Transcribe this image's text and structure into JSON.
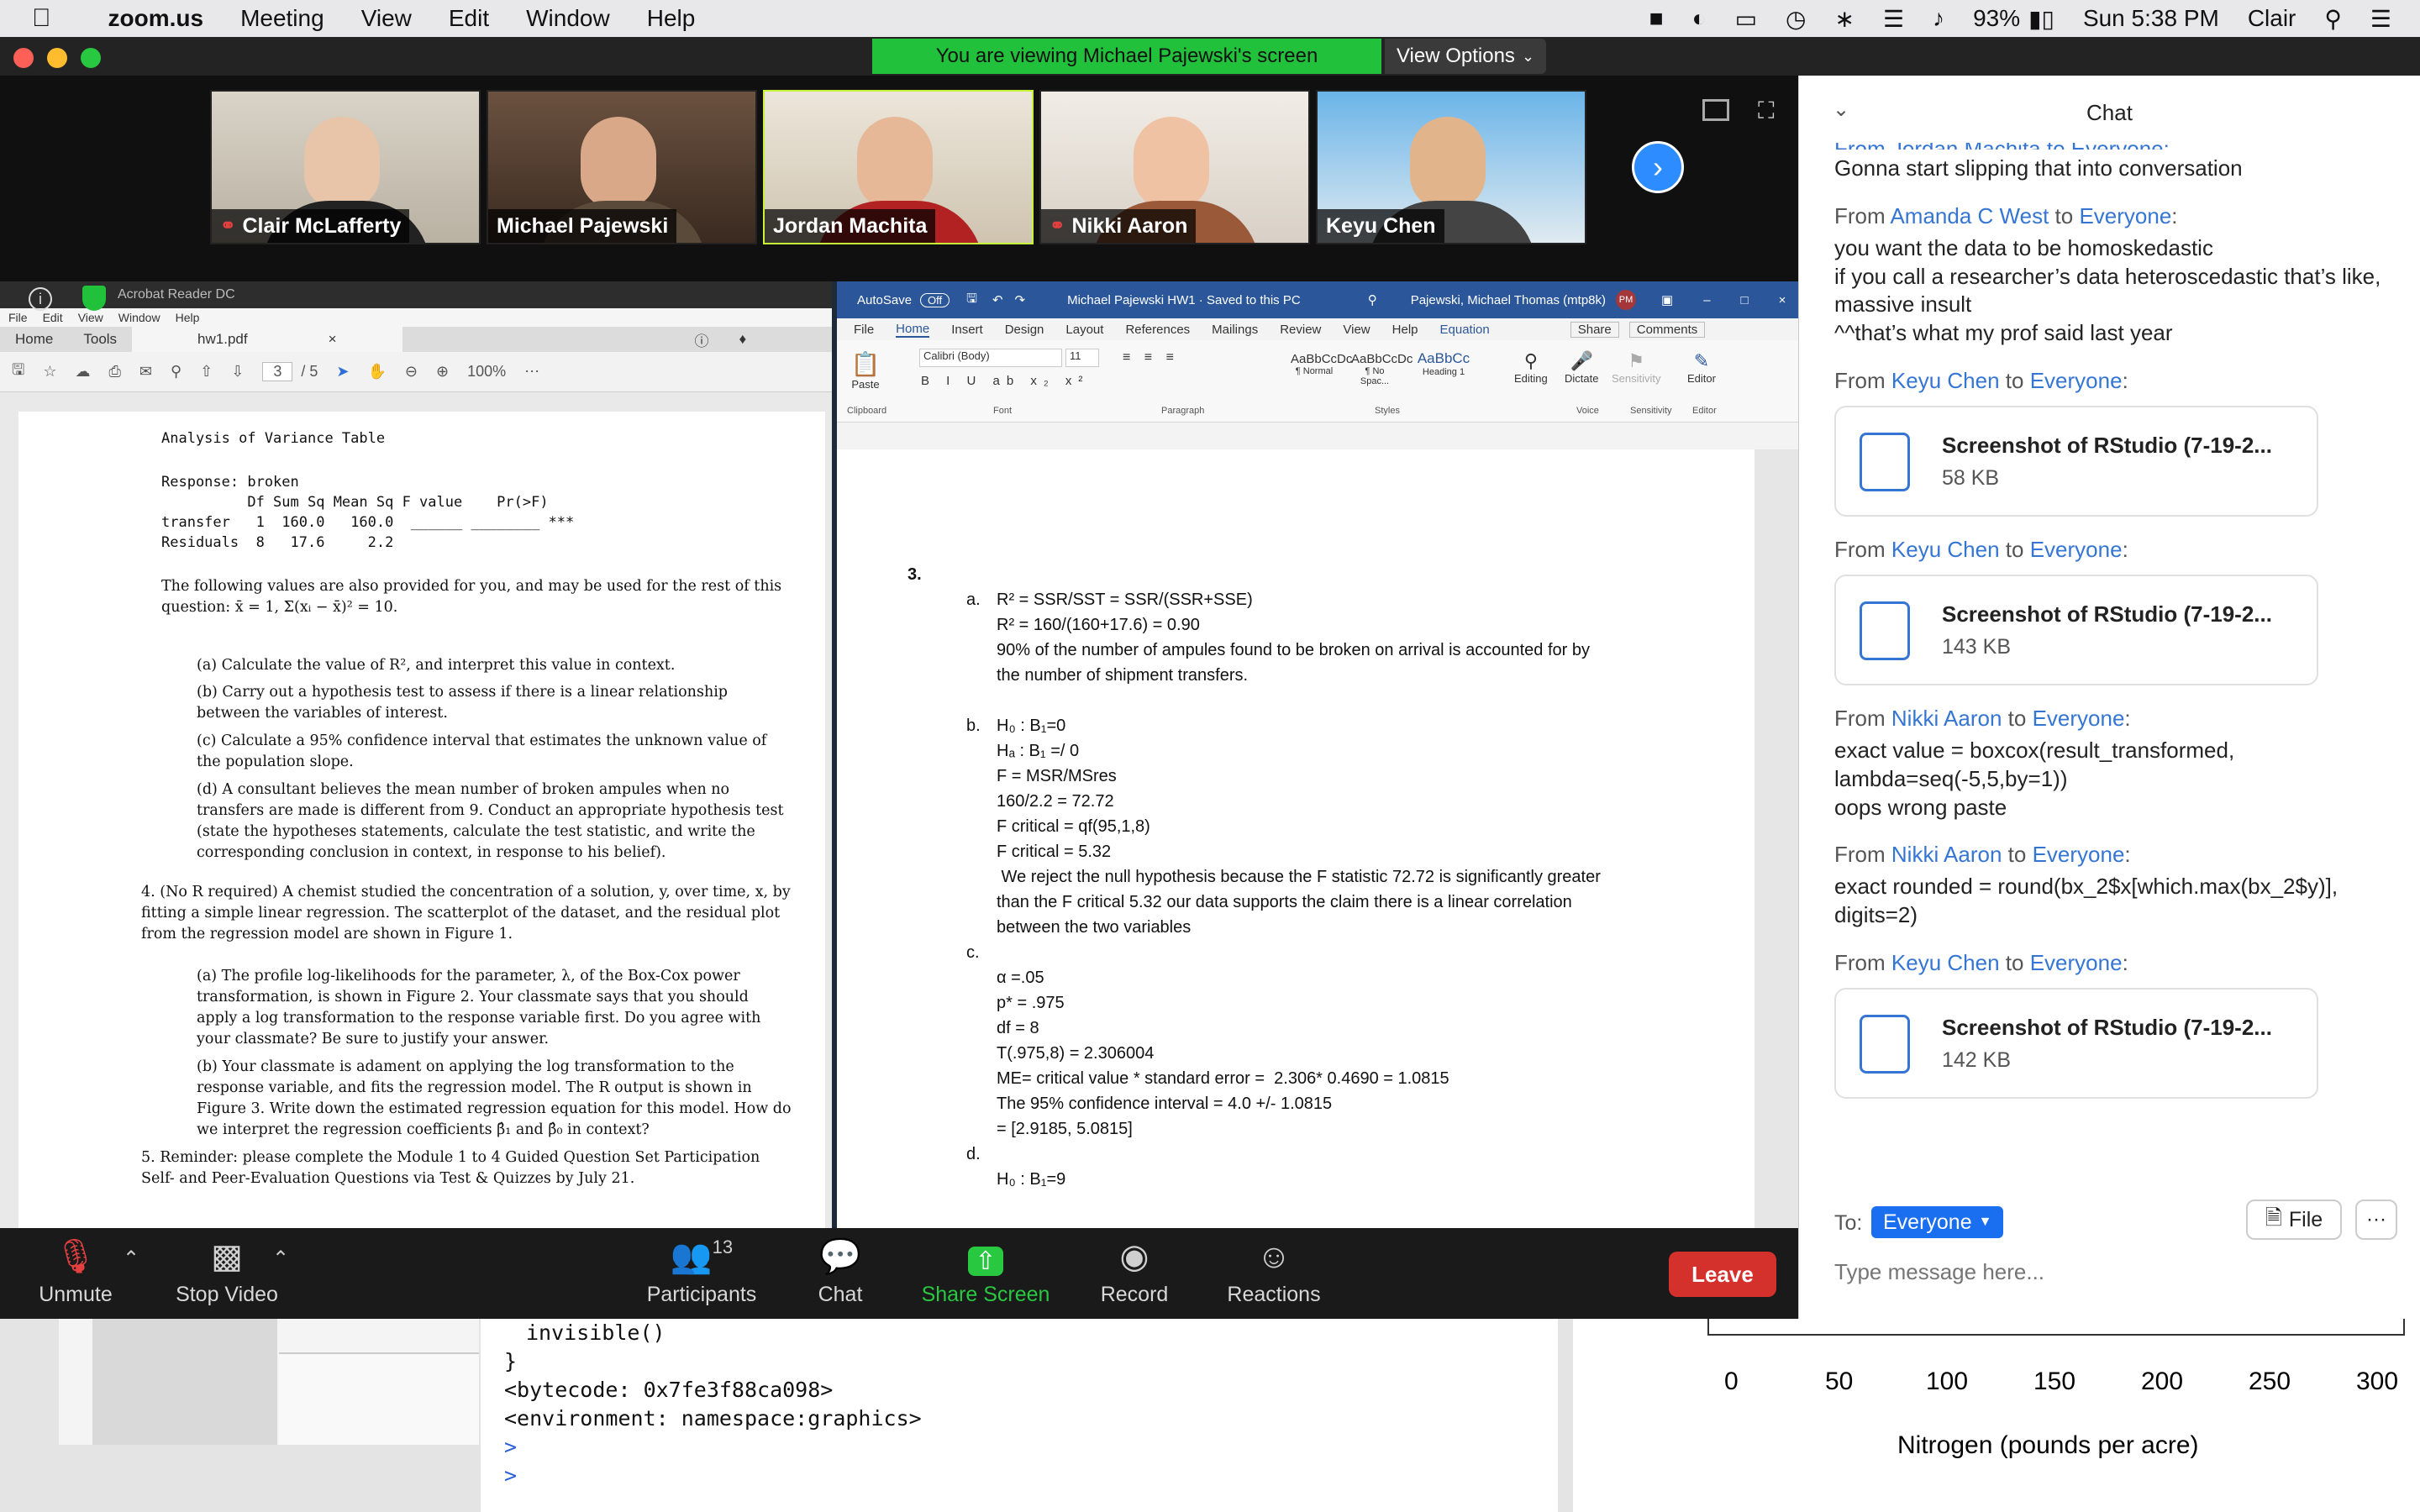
{
  "menubar": {
    "app_name": "zoom.us",
    "items": [
      "Meeting",
      "View",
      "Edit",
      "Window",
      "Help"
    ],
    "battery": "93%",
    "datetime": "Sun 5:38 PM",
    "user": "Clair"
  },
  "banner": {
    "viewing": "You are viewing Michael Pajewski's screen",
    "view_options": "View Options"
  },
  "participants_strip": [
    {
      "name": "Clair McLafferty",
      "muted": true
    },
    {
      "name": "Michael Pajewski",
      "muted": false
    },
    {
      "name": "Jordan Machita",
      "muted": false
    },
    {
      "name": "Nikki Aaron",
      "muted": true
    },
    {
      "name": "Keyu Chen",
      "muted": false
    }
  ],
  "acrobat": {
    "title": "Acrobat Reader DC",
    "menu": [
      "File",
      "Edit",
      "View",
      "Window",
      "Help"
    ],
    "tabs": {
      "home": "Home",
      "tools": "Tools",
      "file": "hw1.pdf"
    },
    "page_current": "3",
    "page_total": "/ 5",
    "zoom": "100%"
  },
  "pdf": {
    "anova_title": "Analysis of Variance Table",
    "anova_response": "Response: broken",
    "anova_header": "          Df Sum Sq Mean Sq F value    Pr(>F)",
    "anova_row1": "transfer   1  160.0   160.0  ______ ________ ***",
    "anova_row2": "Residuals  8   17.6     2.2",
    "intro": "The following values are also provided for you, and may be used for the rest of this question: x̄ = 1, Σ(xᵢ − x̄)² = 10.",
    "qa": "(a) Calculate the value of R², and interpret this value in context.",
    "qb": "(b) Carry out a hypothesis test to assess if there is a linear relationship between the variables of interest.",
    "qc": "(c) Calculate a 95% confidence interval that estimates the unknown value of the population slope.",
    "qd": "(d) A consultant believes the mean number of broken ampules when no transfers are made is different from 9. Conduct an appropriate hypothesis test (state the hypotheses statements, calculate the test statistic, and write the corresponding conclusion in context, in response to his belief).",
    "q4": "4. (No R required) A chemist studied the concentration of a solution, y, over time, x, by fitting a simple linear regression. The scatterplot of the dataset, and the residual plot from the regression model are shown in Figure 1.",
    "q4a": "(a) The profile log-likelihoods for the parameter, λ, of the Box-Cox power transformation, is shown in Figure 2. Your classmate says that you should apply a log transformation to the response variable first. Do you agree with your classmate? Be sure to justify your answer.",
    "q4b": "(b) Your classmate is adament on applying the log transformation to the response variable, and fits the regression model. The R output is shown in Figure 3. Write down the estimated regression equation for this model. How do we interpret the regression coefficients β̂₁ and β̂₀ in context?",
    "q5": "5. Reminder: please complete the Module 1 to 4 Guided Question Set Participation Self- and Peer-Evaluation Questions via Test & Quizzes by July 21."
  },
  "word": {
    "autosave": "AutoSave",
    "autosave_state": "Off",
    "title": "Michael Pajewski HW1 · Saved to this PC",
    "user": "Pajewski, Michael Thomas (mtp8k)",
    "initials": "PM",
    "tabs": [
      "File",
      "Home",
      "Insert",
      "Design",
      "Layout",
      "References",
      "Mailings",
      "Review",
      "View",
      "Help",
      "Equation"
    ],
    "share": "Share",
    "comments": "Comments",
    "font": "Calibri (Body)",
    "size": "11",
    "styles": [
      "¶ Normal",
      "¶ No Spac...",
      "Heading 1"
    ],
    "groups": [
      "Clipboard",
      "Font",
      "Paragraph",
      "Styles",
      "Voice",
      "Sensitivity",
      "Editor"
    ],
    "ribbon_buttons": [
      "Paste",
      "Editing",
      "Dictate",
      "Sensitivity",
      "Editor"
    ],
    "doc": {
      "num": "3.",
      "a_label": "a.",
      "a1": "R² = SSR/SST = SSR/(SSR+SSE)",
      "a2": "R² = 160/(160+17.6) = 0.90",
      "a3": "90% of the number of ampules found to be broken on arrival is accounted for by",
      "a4": "the number of shipment transfers.",
      "b_label": "b.",
      "b1": "H₀ : B₁=0",
      "b2": "Hₐ : B₁ =/ 0",
      "b3": "F = MSR/MSres",
      "b4": "160/2.2 = 72.72",
      "b5": "F critical = qf(95,1,8)",
      "b6": "F critical = 5.32",
      "b7": " We reject the null hypothesis because the F statistic 72.72 is significantly greater",
      "b8": "than the F critical 5.32 our data supports the claim there is a linear correlation",
      "b9": "between the two variables",
      "c_label": "c.",
      "c1": "α =.05",
      "c2": "p* = .975",
      "c3": "df = 8",
      "c4": "T(.975,8) = 2.306004",
      "c5": "ME= critical value * standard error =  2.306* 0.4690 = 1.0815",
      "c6": "The 95% confidence interval = 4.0 +/- 1.0815",
      "c7": "= [2.9185, 5.0815]",
      "d_label": "d.",
      "d1": "H₀ : B₁=9"
    }
  },
  "toolbar": {
    "unmute": "Unmute",
    "stop_video": "Stop Video",
    "participants": "Participants",
    "participants_count": "13",
    "chat": "Chat",
    "share": "Share Screen",
    "record": "Record",
    "reactions": "Reactions",
    "leave": "Leave"
  },
  "chat": {
    "title": "Chat",
    "partial_top": "From Jordan Machita to Everyone:",
    "first_text": "Gonna start slipping that into conversation",
    "messages": [
      {
        "from": "Amanda C West",
        "to": "Everyone",
        "lines": [
          "you want the data to be homoskedastic",
          "if you call a researcher’s data heteroscedastic that’s like, massive insult",
          "^^that’s what my prof said last year"
        ]
      },
      {
        "from": "Keyu Chen",
        "to": "Everyone",
        "file": "Screenshot of RStudio (7-19-2...",
        "size": "58 KB"
      },
      {
        "from": "Keyu Chen",
        "to": "Everyone",
        "file": "Screenshot of RStudio (7-19-2...",
        "size": "143 KB"
      },
      {
        "from": "Nikki Aaron",
        "to": "Everyone",
        "lines": [
          "exact value = boxcox(result_transformed, lambda=seq(-5,5,by=1))",
          "oops wrong paste"
        ]
      },
      {
        "from": "Nikki Aaron",
        "to": "Everyone",
        "lines": [
          "exact rounded = round(bx_2$x[which.max(bx_2$y)], digits=2)"
        ]
      },
      {
        "from": "Keyu Chen",
        "to": "Everyone",
        "file": "Screenshot of RStudio (7-19-2...",
        "size": "142 KB"
      }
    ],
    "from_word": "From",
    "to_word": "to",
    "to_label": "To:",
    "recipient": "Everyone",
    "file_button": "File",
    "more": "···",
    "placeholder": "Type message here..."
  },
  "background": {
    "console_lines": [
      "invisible()",
      "}",
      "<bytecode: 0x7fe3f88ca098>",
      "<environment: namespace:graphics>",
      ">",
      ">"
    ],
    "axis_ticks": [
      "0",
      "50",
      "100",
      "150",
      "200",
      "250",
      "300"
    ],
    "axis_label": "Nitrogen (pounds per acre)"
  }
}
